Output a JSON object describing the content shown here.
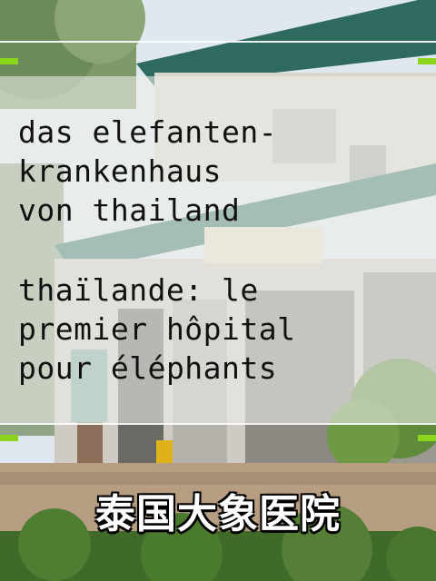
{
  "captions": {
    "german": "das elefanten-\nkrankenhaus\nvon thailand",
    "french": "thaïlande: le\npremier hôpital\npour éléphants"
  },
  "title_chinese": "泰国大象医院",
  "colors": {
    "accent_marker": "#8bd51c",
    "overlay_panel": "#f0f0ec",
    "caption_text": "#111111",
    "title_text": "#ffffff",
    "roof_teal": "#2e6b5e"
  }
}
